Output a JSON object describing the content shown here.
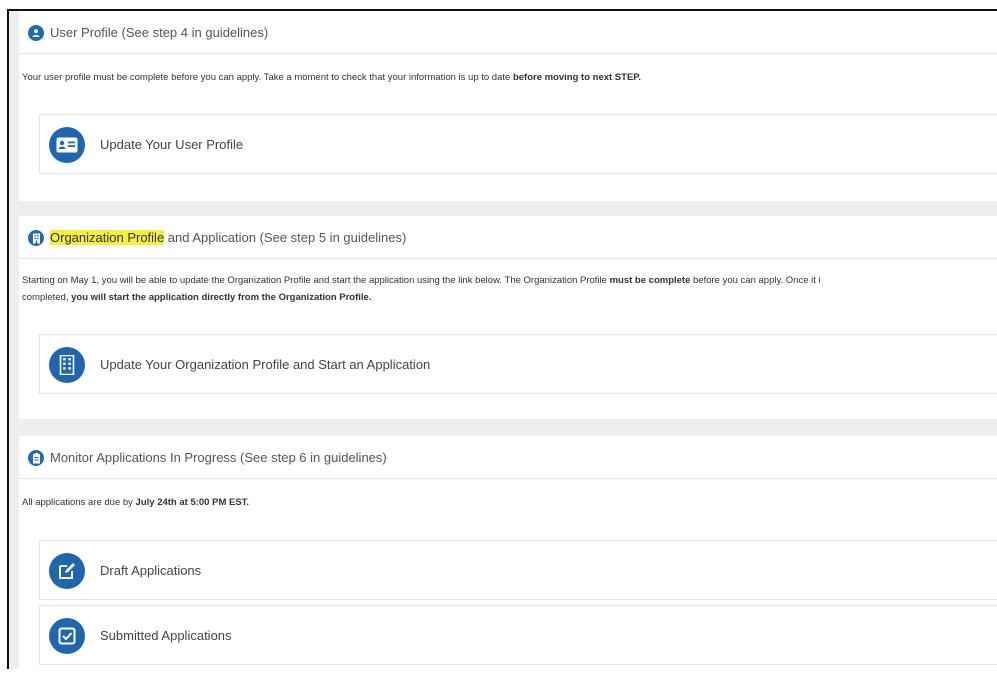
{
  "sections": [
    {
      "title": "User Profile (See step 4 in guidelines)",
      "description_plain": "Your user profile must be complete before you can apply. Take a moment to check that your information is up to date ",
      "description_bold": "before moving to next STEP.",
      "cards": [
        {
          "label": "Update Your User Profile",
          "icon": "id-card-icon"
        }
      ]
    },
    {
      "title_highlight": "Organization Profile",
      "title_rest": " and Application (See step 5 in guidelines)",
      "line1_a": "Starting on May 1, you will be able to update the Organization Profile and start the application using the link below. The Organization Profile ",
      "line1_b": "must be complete",
      "line1_c": " before you can apply. Once it i",
      "line2_a": "completed, ",
      "line2_b": "you will start the application directly from the Organization Profile.",
      "cards": [
        {
          "label": "Update Your Organization Profile and Start an Application",
          "icon": "building-icon"
        }
      ]
    },
    {
      "title": "Monitor Applications In Progress (See step 6 in guidelines)",
      "description_plain": "All applications are due by ",
      "description_bold": "July 24th at 5:00 PM EST.",
      "cards": [
        {
          "label": "Draft Applications",
          "icon": "edit-icon"
        },
        {
          "label": "Submitted Applications",
          "icon": "checkbox-icon"
        }
      ]
    }
  ],
  "colors": {
    "accent": "#1f69b5",
    "highlight": "#f4ef3a",
    "background": "#eeeeee"
  }
}
